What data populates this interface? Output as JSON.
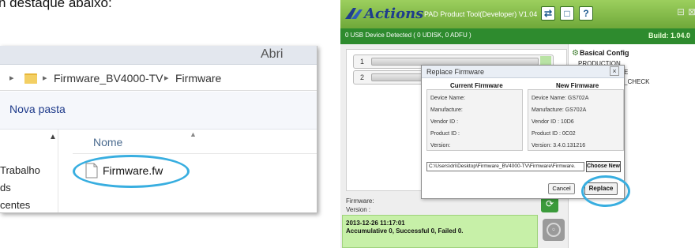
{
  "caption": "n destaque abaixo:",
  "explorer": {
    "title_fragment": "Abri",
    "breadcrumb": [
      "Firmware_BV4000-TV",
      "Firmware"
    ],
    "toolbar_new_folder": "Nova pasta",
    "nav_items": [
      "Trabalho",
      "ds",
      "centes"
    ],
    "column_name": "Nome",
    "file_name": "Firmware.fw"
  },
  "tool": {
    "logo": "Actions",
    "title": "PAD Product Tool(Developer) V1.04",
    "status_left": "0 USB Device Detected ( 0 UDISK, 0 ADFU )",
    "status_right": "Build: 1.04.0",
    "slots": [
      "1",
      "2"
    ],
    "config_title": "Basical Config",
    "config_items": [
      "PRODUCTION",
      "E",
      "_CHECK"
    ],
    "firmware_label": "Firmware:",
    "version_label": "Version :",
    "log": [
      "2013-12-26 11:17:01",
      "Accumulative 0, Successful 0, Failed 0."
    ]
  },
  "dialog": {
    "title": "Replace Firmware",
    "current_heading": "Current Firmware",
    "new_heading": "New Firmware",
    "current": [
      "Device Name:",
      "Manufacture:",
      "Vendor ID :",
      "Product ID :",
      "Version:"
    ],
    "new": [
      "Device Name: GS702A",
      "Manufacture: GS702A",
      "Vendor ID : 10D6",
      "Product ID : 0C02",
      "Version: 3.4.0.131216"
    ],
    "path": "C:\\Users\\dri\\Desktop\\Firmware_BV4000-TV\\Firmware\\Firmware.",
    "choose_label": "Choose New",
    "cancel_label": "Cancel",
    "replace_label": "Replace"
  },
  "colors": {
    "accent_ring": "#38aee0",
    "tool_green": "#6fa83a",
    "status_green": "#2e8b2e"
  }
}
